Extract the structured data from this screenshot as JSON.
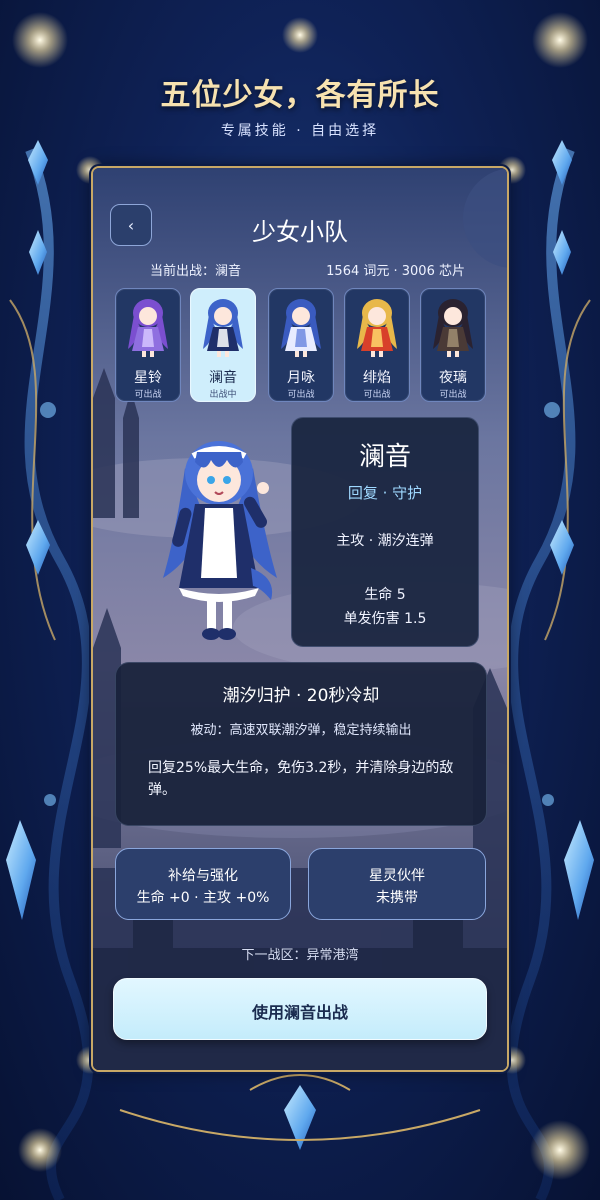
{
  "header": {
    "title": "五位少女，各有所长",
    "subtitle": "专属技能 · 自由选择"
  },
  "panel": {
    "back_label": "‹",
    "title": "少女小队",
    "current_deploy": "当前出战：澜音",
    "currency": "1564 词元 · 3006 芯片"
  },
  "roster": [
    {
      "name": "星铃",
      "status": "可出战",
      "selected": false,
      "palette": {
        "hair": "#7b4fd0",
        "dress": "#8f6fe0",
        "accent": "#d6c6ff"
      }
    },
    {
      "name": "澜音",
      "status": "出战中",
      "selected": true,
      "palette": {
        "hair": "#3d63c9",
        "dress": "#1f2f6a",
        "accent": "#ffffff"
      }
    },
    {
      "name": "月咏",
      "status": "可出战",
      "selected": false,
      "palette": {
        "hair": "#3a5bc0",
        "dress": "#e8ecff",
        "accent": "#6d8ae0"
      }
    },
    {
      "name": "绯焰",
      "status": "可出战",
      "selected": false,
      "palette": {
        "hair": "#e8b84a",
        "dress": "#d8402a",
        "accent": "#ffd86b"
      }
    },
    {
      "name": "夜璃",
      "status": "可出战",
      "selected": false,
      "palette": {
        "hair": "#2a2230",
        "dress": "#4a3a36",
        "accent": "#a08e72"
      }
    }
  ],
  "stats": {
    "name": "澜音",
    "role": "回复 · 守护",
    "weapon": "主攻 · 潮汐连弹",
    "hp": "生命 5",
    "damage": "单发伤害 1.5"
  },
  "skill": {
    "title": "潮汐归护 · 20秒冷却",
    "passive": "被动：高速双联潮汐弹，稳定持续输出",
    "active": "回复25%最大生命，免伤3.2秒，并清除身边的敌弹。"
  },
  "buttons": {
    "upgrade_line1": "补给与强化",
    "upgrade_line2": "生命 +0 · 主攻 +0%",
    "companion_line1": "星灵伙伴",
    "companion_line2": "未携带",
    "deploy": "使用澜音出战"
  },
  "next_zone": "下一战区：异常港湾",
  "colors": {
    "gold": "#c8a866",
    "accent_blue": "#9fd8ff",
    "selected_card": "#cfeefc"
  }
}
